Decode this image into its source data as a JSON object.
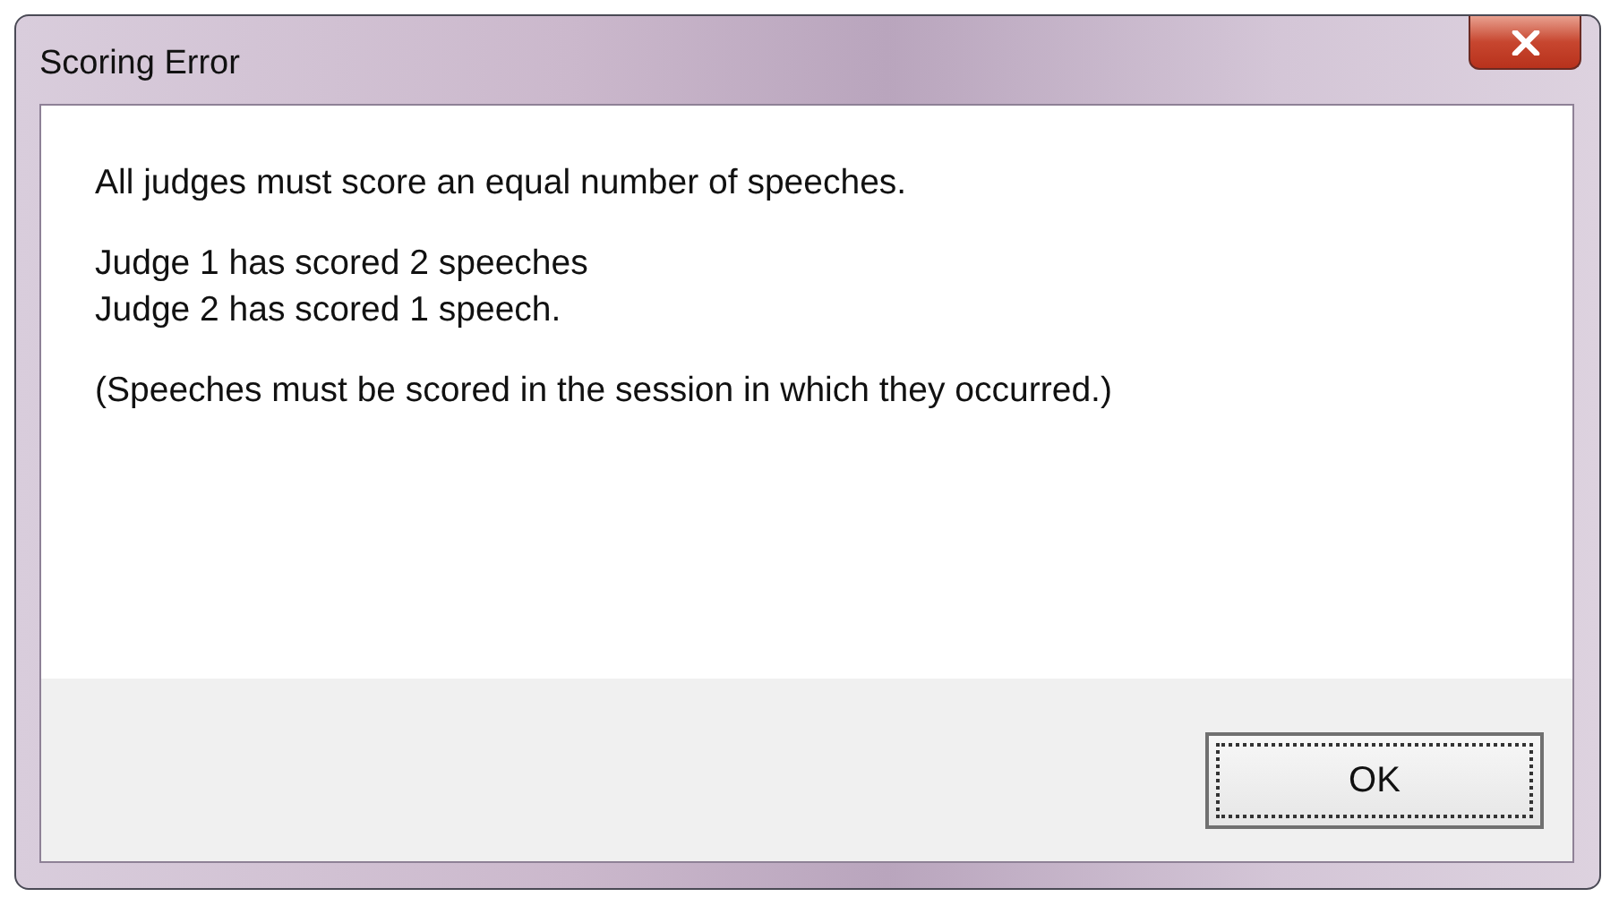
{
  "window": {
    "title": "Scoring Error"
  },
  "message": {
    "paragraphs": [
      [
        "All judges must score an equal number of speeches."
      ],
      [
        "Judge 1 has scored 2 speeches",
        "Judge 2 has scored 1 speech."
      ],
      [
        "(Speeches must be scored in the session in which they occurred.)"
      ]
    ]
  },
  "buttons": [
    {
      "label": "OK",
      "focused": true
    }
  ]
}
